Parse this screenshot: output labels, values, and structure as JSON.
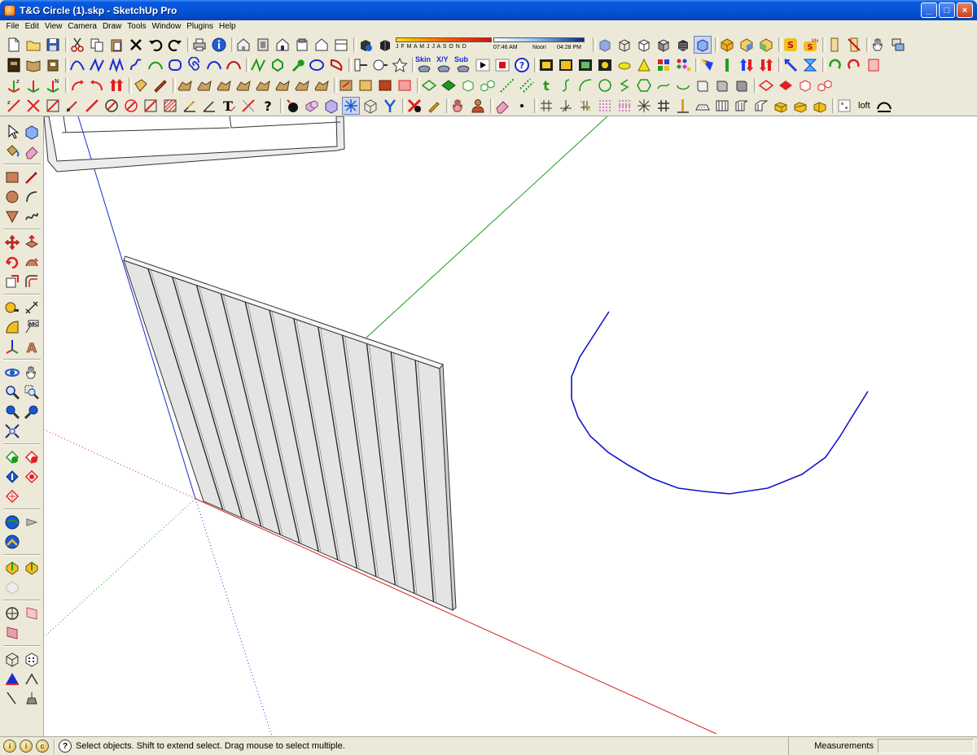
{
  "window": {
    "title": "T&G Circle (1).skp - SketchUp Pro",
    "buttons": {
      "minimize": "_",
      "maximize": "□",
      "close": "×"
    }
  },
  "menu": [
    "File",
    "Edit",
    "View",
    "Camera",
    "Draw",
    "Tools",
    "Window",
    "Plugins",
    "Help"
  ],
  "shadow": {
    "months": "J F M A M J J A S O N D",
    "time_start": "07:46 AM",
    "time_mid": "Noon",
    "time_end": "04:28 PM"
  },
  "toolbar_text": {
    "skin": "Skin",
    "xy": "X/Y",
    "sub": "Sub",
    "loft": "loft"
  },
  "status": {
    "message": "Select objects. Shift to extend select. Drag mouse to select multiple.",
    "measurements_label": "Measurements",
    "measurements_value": "",
    "help_glyph": "?"
  },
  "colors": {
    "axis_red": "#d42020",
    "axis_green": "#1a9a1a",
    "axis_blue": "#1a2bd0",
    "curve_blue": "#1414c8",
    "panel_face": "#e4e4e4"
  }
}
